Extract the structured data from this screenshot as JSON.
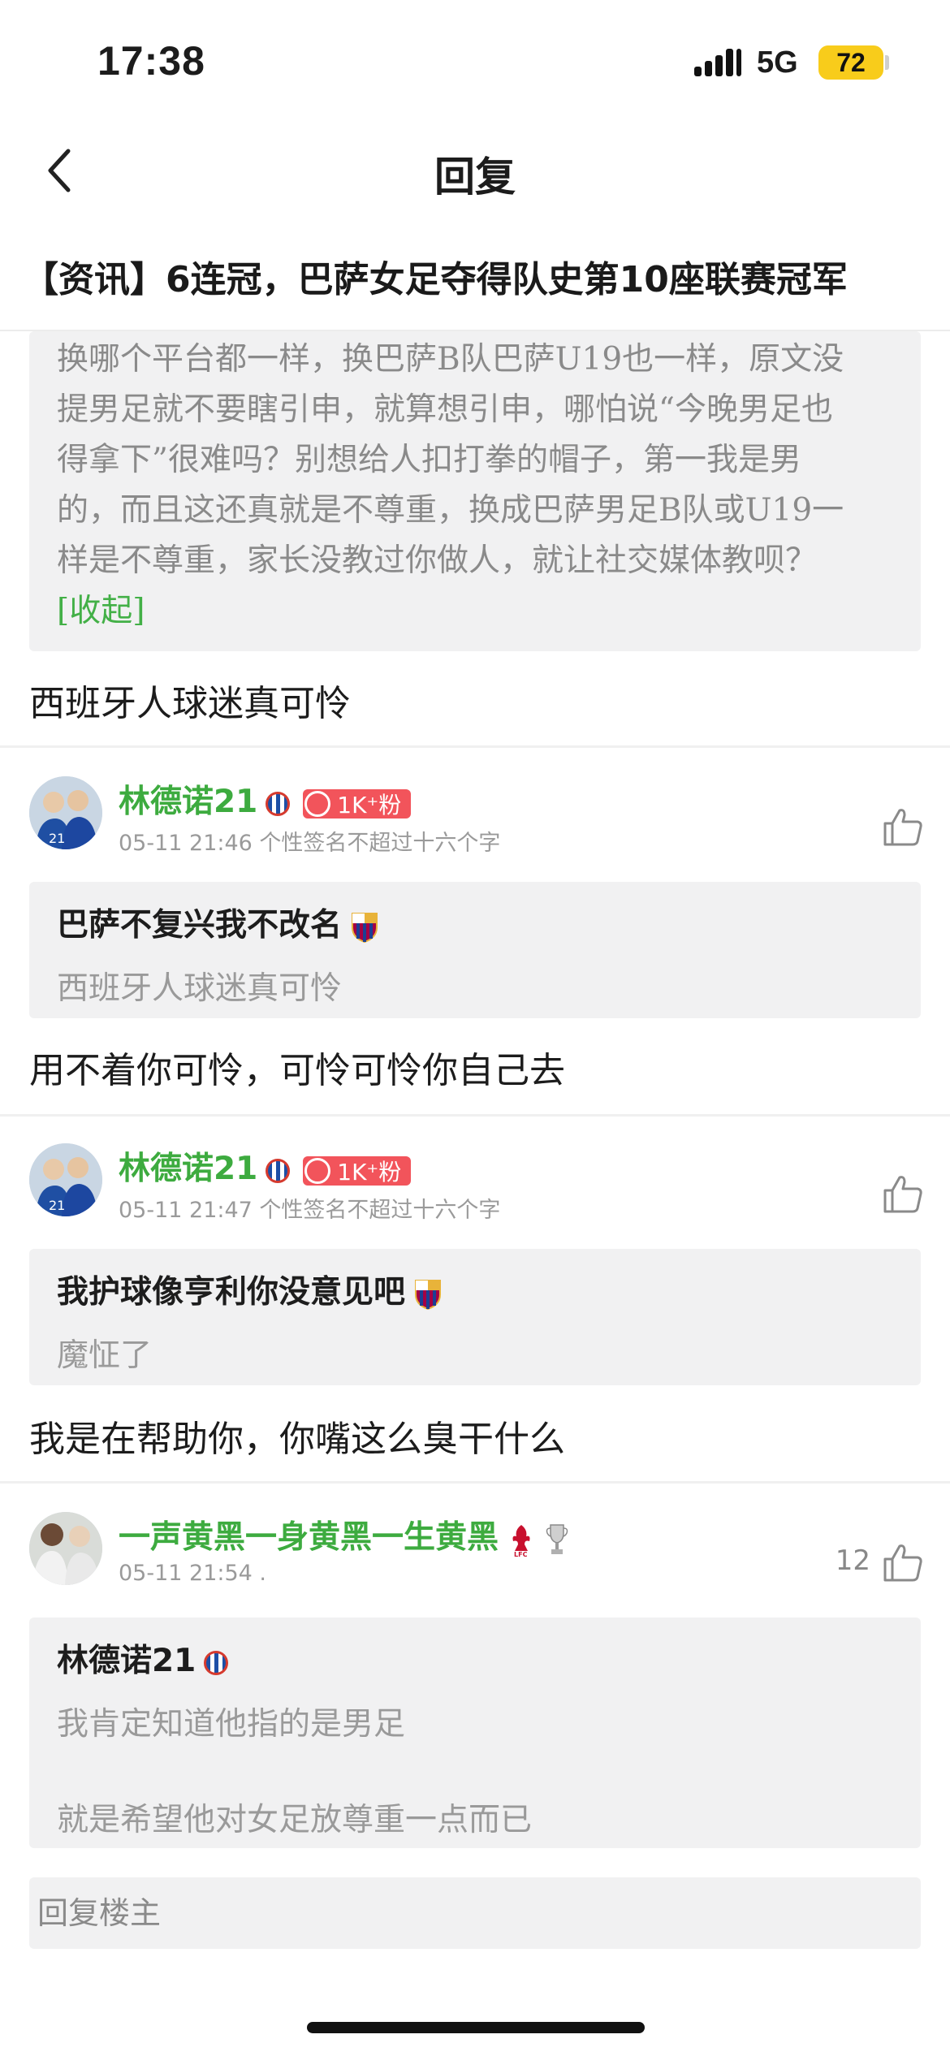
{
  "status_bar": {
    "time": "17:38",
    "network": "5G",
    "battery": "72"
  },
  "nav": {
    "title": "回复"
  },
  "article": {
    "title": "【资讯】6连冠，巴萨女足夺得队史第10座联赛冠军"
  },
  "long_quote": {
    "lines": [
      "换哪个平台都一样，换巴萨B队巴萨U19也一样，原文没",
      "提男足就不要瞎引申，就算想引申，哪怕说“今晚男足也",
      "得拿下”很难吗？别想给人扣打拳的帽子，第一我是男",
      "的，而且这还真就是不尊重，换成巴萨男足B队或U19一",
      "样是不尊重，家长没教过你做人，就让社交媒体教呗？"
    ],
    "collapse": "[收起]"
  },
  "reply_1": "西班牙人球迷真可怜",
  "comments": [
    {
      "username": "林德诺21",
      "fans": "1K⁺粉",
      "meta": "05-11 21:46 个性签名不超过十六个字",
      "like_count": "",
      "quote_author": "巴萨不复兴我不改名",
      "quote_text": "西班牙人球迷真可怜",
      "reply": "用不着你可怜，可怜可怜你自己去"
    },
    {
      "username": "林德诺21",
      "fans": "1K⁺粉",
      "meta": "05-11 21:47 个性签名不超过十六个字",
      "like_count": "",
      "quote_author": "我护球像亨利你没意见吧",
      "quote_text": "魔怔了",
      "reply": "我是在帮助你，你嘴这么臭干什么"
    },
    {
      "username": "一声黄黑一身黄黑一生黄黑",
      "meta": "05-11 21:54 .",
      "like_count": "12",
      "quote_author": "林德诺21",
      "quote_lines": [
        "我肯定知道他指的是男足",
        "就是希望他对女足放尊重一点而已"
      ]
    }
  ],
  "reply_op": "回复楼主",
  "colors": {
    "username": "#3dab3f",
    "fans_badge": "#f2545b",
    "battery": "#f8cc1b",
    "quote_bg": "#f1f1f2"
  },
  "icons": [
    "back-chevron-icon",
    "signal-icon",
    "thumbs-up-icon",
    "espanyol-badge-icon",
    "barcelona-crest-icon",
    "liverpool-crest-icon",
    "trophy-icon"
  ]
}
